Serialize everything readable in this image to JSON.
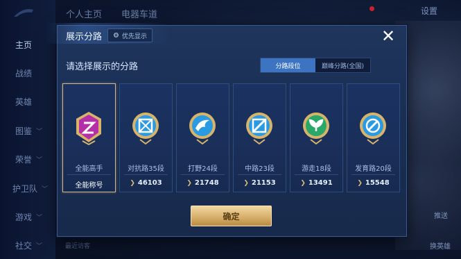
{
  "background": {
    "top_tabs": [
      "个人主页",
      "电器车道"
    ],
    "settings": "设置",
    "nav": [
      {
        "label": "主页",
        "chevron": false,
        "active": true
      },
      {
        "label": "战绩",
        "chevron": false
      },
      {
        "label": "英雄",
        "chevron": false
      },
      {
        "label": "图鉴",
        "chevron": true
      },
      {
        "label": "荣誉",
        "chevron": true
      },
      {
        "label": "护卫队",
        "chevron": true
      },
      {
        "label": "游戏",
        "chevron": true
      },
      {
        "label": "社交",
        "chevron": true
      }
    ],
    "recent_visitors": "最近访客",
    "bottom_right_labels": [
      "推送",
      "换英雄"
    ]
  },
  "modal": {
    "title": "展示分路",
    "priority_label": "优先显示",
    "close_icon": "close-icon",
    "subtitle": "请选择展示的分路",
    "toggle": {
      "active": "分路段位",
      "inactive": "巅峰分路(全国)"
    },
    "cards": [
      {
        "name": "全能高手",
        "tag": "全能称号",
        "icon": "all-round-badge-icon",
        "color": "#b42fa8",
        "selected": true
      },
      {
        "name": "对抗路35段",
        "score": "46103",
        "icon": "clash-lane-badge-icon",
        "color": "#2a9be3"
      },
      {
        "name": "打野24段",
        "score": "21748",
        "icon": "jungle-badge-icon",
        "color": "#2a9be3"
      },
      {
        "name": "中路23段",
        "score": "21153",
        "icon": "mid-lane-badge-icon",
        "color": "#2a9be3"
      },
      {
        "name": "游走18段",
        "score": "13491",
        "icon": "roam-badge-icon",
        "color": "#2aa86a"
      },
      {
        "name": "发育路20段",
        "score": "15548",
        "icon": "farm-lane-badge-icon",
        "color": "#2a9be3"
      }
    ],
    "confirm": "确定"
  }
}
